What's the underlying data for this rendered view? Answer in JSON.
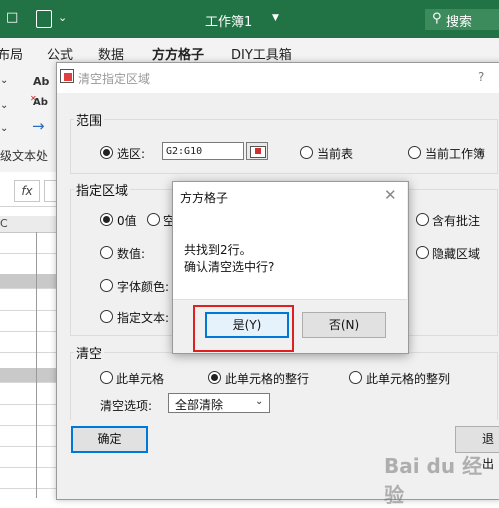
{
  "excel": {
    "window_title": "工作簿1",
    "search_label": "搜索",
    "ribbon_tabs": [
      "布局",
      "公式",
      "数据",
      "方方格子",
      "DIY工具箱"
    ],
    "ribbon_group_label": "级文本处",
    "formula_fx": "fx",
    "column_header": "C",
    "accent_color": "#217346"
  },
  "main_dialog": {
    "title": "清空指定区域",
    "help": "?",
    "range_group": {
      "title": "范围",
      "options": [
        "选区:",
        "当前表",
        "当前工作簿"
      ],
      "selected": "选区:",
      "range_value": "G2:G10"
    },
    "area_group": {
      "title": "指定区域",
      "options": {
        "value": "0值",
        "empty": "空",
        "number": "数值:",
        "font_color": "字体颜色:",
        "text": "指定文本:",
        "has_comment": "含有批注",
        "hidden_area": "隐藏区域"
      },
      "selected": "0值"
    },
    "clear_group": {
      "title": "清空",
      "options": [
        "此单元格",
        "此单元格的整行",
        "此单元格的整列"
      ],
      "selected": "此单元格的整行",
      "option_label": "清空选项:",
      "option_value": "全部清除"
    },
    "confirm_label": "确定",
    "exit_label": "退出"
  },
  "message_box": {
    "title": "方方格子",
    "line1": "共找到2行。",
    "line2": "确认清空选中行?",
    "yes_label": "是(Y)",
    "no_label": "否(N)"
  },
  "watermark": "Bai du 经验"
}
